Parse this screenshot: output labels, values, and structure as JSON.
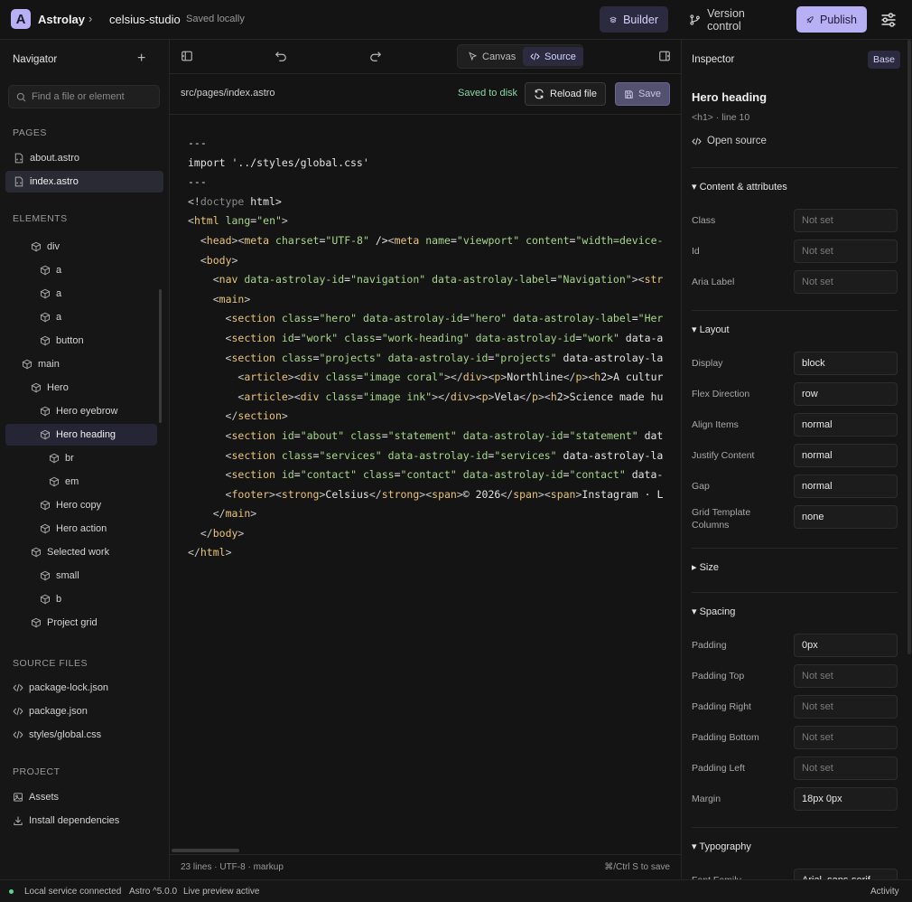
{
  "app": {
    "logo_letter": "A",
    "brand": "Astrolay",
    "breadcrumb_sep": "›",
    "project": "celsius-studio",
    "save_status": "Saved locally"
  },
  "topbar": {
    "builder_label": "Builder",
    "version_control_label": "Version control",
    "publish_label": "Publish"
  },
  "navigator": {
    "title": "Navigator",
    "search_placeholder": "Find a file or element",
    "pages_label": "PAGES",
    "pages": [
      "about.astro",
      "index.astro"
    ],
    "elements_label": "ELEMENTS",
    "elements": [
      {
        "label": "div",
        "level": 1
      },
      {
        "label": "a",
        "level": 2
      },
      {
        "label": "a",
        "level": 2
      },
      {
        "label": "a",
        "level": 2
      },
      {
        "label": "button",
        "level": 2
      },
      {
        "label": "main",
        "level": 0
      },
      {
        "label": "Hero",
        "level": 1
      },
      {
        "label": "Hero eyebrow",
        "level": 2
      },
      {
        "label": "Hero heading",
        "level": 2
      },
      {
        "label": "br",
        "level": 3
      },
      {
        "label": "em",
        "level": 3
      },
      {
        "label": "Hero copy",
        "level": 2
      },
      {
        "label": "Hero action",
        "level": 2
      },
      {
        "label": "Selected work",
        "level": 1
      },
      {
        "label": "small",
        "level": 2
      },
      {
        "label": "b",
        "level": 2
      },
      {
        "label": "Project grid",
        "level": 1
      }
    ],
    "source_files_label": "SOURCE FILES",
    "source_files": [
      "package-lock.json",
      "package.json",
      "styles/global.css"
    ],
    "project_label": "PROJECT",
    "project_items": [
      "Assets",
      "Install dependencies"
    ]
  },
  "editor": {
    "mode_canvas": "Canvas",
    "mode_source": "Source",
    "file_path": "src/pages/index.astro",
    "disk_status": "Saved to disk",
    "reload_label": "Reload file",
    "save_label": "Save",
    "footer_meta": "23 lines · UTF-8 · markup",
    "footer_hint": "⌘/Ctrl S to save",
    "code_lines": [
      "---",
      "import '../styles/global.css'",
      "---",
      "<!doctype html>",
      "<html lang=\"en\">",
      "  <head><meta charset=\"UTF-8\" /><meta name=\"viewport\" content=\"width=device-",
      "  <body>",
      "    <nav data-astrolay-id=\"navigation\" data-astrolay-label=\"Navigation\"><str",
      "    <main>",
      "      <section class=\"hero\" data-astrolay-id=\"hero\" data-astrolay-label=\"Her",
      "      <section id=\"work\" class=\"work-heading\" data-astrolay-id=\"work\" data-a",
      "      <section class=\"projects\" data-astrolay-id=\"projects\" data-astrolay-la",
      "        <article><div class=\"image coral\"></div><p>Northline</p><h2>A cultur",
      "        <article><div class=\"image ink\"></div><p>Vela</p><h2>Science made hu",
      "      </section>",
      "      <section id=\"about\" class=\"statement\" data-astrolay-id=\"statement\" dat",
      "      <section class=\"services\" data-astrolay-id=\"services\" data-astrolay-la",
      "      <section id=\"contact\" class=\"contact\" data-astrolay-id=\"contact\" data-",
      "      <footer><strong>Celsius</strong><span>© 2026</span><span>Instagram · L",
      "    </main>",
      "  </body>",
      "</html>"
    ]
  },
  "inspector": {
    "title": "Inspector",
    "badge": "Base",
    "element_name": "Hero heading",
    "element_meta": "<h1> · line 10",
    "open_source": "Open source",
    "groups": {
      "content": "▾ Content & attributes",
      "layout": "▾ Layout",
      "size": "▸ Size",
      "spacing": "▾ Spacing",
      "typography": "▾ Typography"
    },
    "content_props": [
      {
        "label": "Class",
        "value": "Not set",
        "empty": true
      },
      {
        "label": "Id",
        "value": "Not set",
        "empty": true
      },
      {
        "label": "Aria Label",
        "value": "Not set",
        "empty": true
      }
    ],
    "layout_props": [
      {
        "label": "Display",
        "value": "block",
        "empty": false
      },
      {
        "label": "Flex Direction",
        "value": "row",
        "empty": false
      },
      {
        "label": "Align Items",
        "value": "normal",
        "empty": false
      },
      {
        "label": "Justify Content",
        "value": "normal",
        "empty": false
      },
      {
        "label": "Gap",
        "value": "normal",
        "empty": false
      },
      {
        "label": "Grid Template Columns",
        "value": "none",
        "empty": false
      }
    ],
    "spacing_props": [
      {
        "label": "Padding",
        "value": "0px",
        "empty": false
      },
      {
        "label": "Padding Top",
        "value": "Not set",
        "empty": true
      },
      {
        "label": "Padding Right",
        "value": "Not set",
        "empty": true
      },
      {
        "label": "Padding Bottom",
        "value": "Not set",
        "empty": true
      },
      {
        "label": "Padding Left",
        "value": "Not set",
        "empty": true
      },
      {
        "label": "Margin",
        "value": "18px 0px",
        "empty": false
      }
    ],
    "typography_props": [
      {
        "label": "Font Family",
        "value": "Arial, sans-serif",
        "empty": false
      }
    ]
  },
  "statusbar": {
    "connection": "Local service connected",
    "version": "Astro ^5.0.0",
    "preview": "Live preview active",
    "activity": "Activity"
  },
  "colors": {
    "accent": "#b8b0f4",
    "selected_bg": "#262535",
    "success": "#8bd7a8",
    "status_dot": "#5fd28f"
  }
}
